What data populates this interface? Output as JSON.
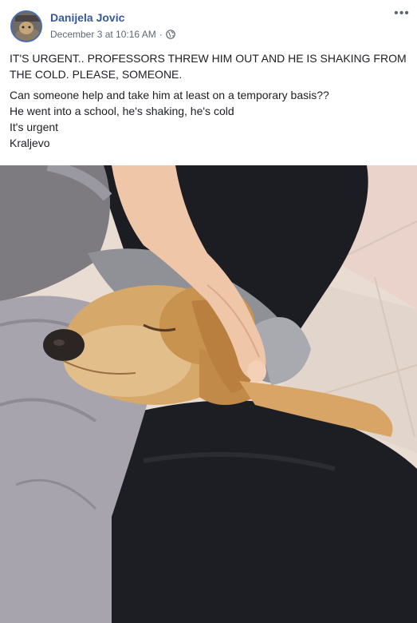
{
  "post": {
    "author": "Danijela Jovic",
    "timestamp": "December 3 at 10:16 AM",
    "separator": "·",
    "privacy_icon": "globe-icon",
    "more_icon": "more-options-icon",
    "more_label": "•••",
    "headline": "IT'S URGENT.. PROFESSORS THREW HIM OUT AND HE IS SHAKING FROM THE COLD. PLEASE, SOMEONE.",
    "body_lines": [
      "Can someone help and take him at least on a temporary basis??",
      "He went into a school, he's shaking, he's cold",
      "It's urgent",
      "Kraljevo"
    ]
  },
  "colors": {
    "author": "#385898",
    "meta": "#616770",
    "text": "#1c1e21"
  }
}
